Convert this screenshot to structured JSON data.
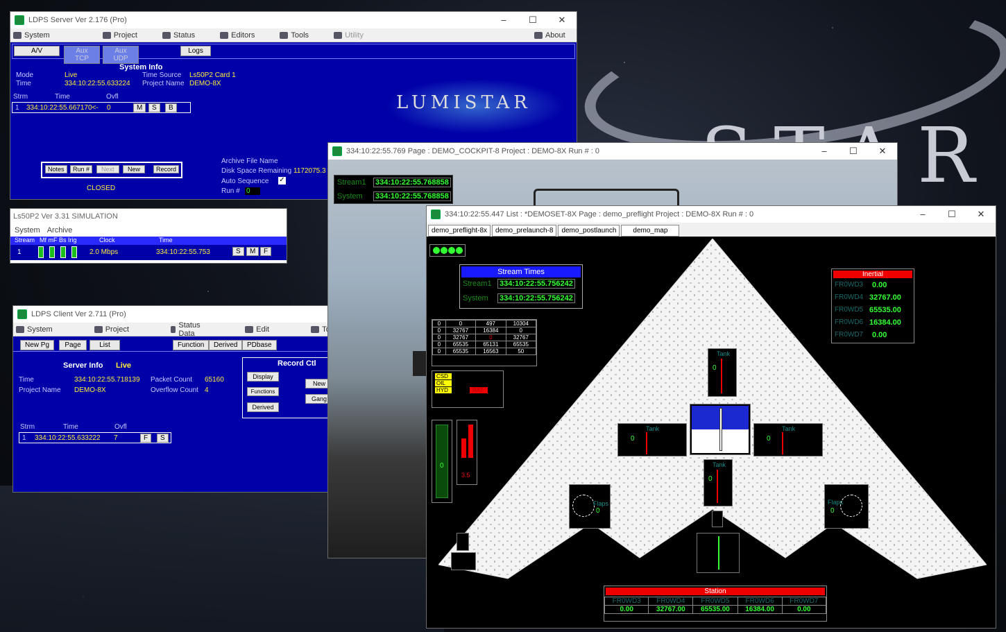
{
  "server": {
    "title": "LDPS Server  Ver 2.176  (Pro)",
    "menu": [
      "System",
      "Project",
      "Status",
      "Editors",
      "Tools",
      "Utility",
      "About"
    ],
    "toolbar": {
      "av": "A/V",
      "tcp": "Aux TCP",
      "udp": "Aux UDP",
      "logs": "Logs"
    },
    "system_info_title": "System Info",
    "mode_label": "Mode",
    "mode_value": "Live",
    "time_label": "Time",
    "time_value": "334:10:22:55.633224",
    "time_source_label": "Time Source",
    "time_source_value": "Ls50P2  Card 1",
    "project_name_label": "Project Name",
    "project_name_value": "DEMO-8X",
    "cols": {
      "strm": "Strm",
      "time": "Time",
      "ovfl": "Ovfl"
    },
    "row": {
      "strm": "1",
      "time": "334:10:22:55.667170<-",
      "ovfl": "0"
    },
    "row_btns": [
      "M",
      "S",
      "B"
    ],
    "record_btns": [
      "Notes",
      "Run #",
      "Next",
      "New",
      "Record"
    ],
    "closed": "CLOSED",
    "archive_label": "Archive File Name",
    "disk_label": "Disk Space Remaining",
    "disk_value": "1172075.3",
    "autoseq_label": "Auto Sequence",
    "run_label": "Run #",
    "run_value": "0",
    "logo": "LUMISTAR"
  },
  "ls50": {
    "title": "Ls50P2 Ver 3.31  SIMULATION",
    "menu": [
      "System",
      "Archive"
    ],
    "header": {
      "stream": "Stream",
      "flags": "Mf  mF  Bs  Irig",
      "clock": "Clock",
      "time": "Time"
    },
    "row": {
      "stream": "1",
      "clock": "2.0 Mbps",
      "time": "334:10:22:55.753"
    },
    "btns": [
      "S",
      "M",
      "F"
    ]
  },
  "client": {
    "title": "LDPS Client  Ver 2.711  (Pro)",
    "menu": [
      "System",
      "Project",
      "Status Data",
      "Edit",
      "Tools"
    ],
    "toolbar": [
      "New Pg",
      "Page",
      "List",
      "Function",
      "Derived",
      "PDbase"
    ],
    "server_info_label": "Server Info",
    "server_info_value": "Live",
    "time_label": "Time",
    "time_value": "334:10:22:55.718139",
    "project_label": "Project Name",
    "project_value": "DEMO-8X",
    "packet_label": "Packet Count",
    "packet_value": "65160",
    "overflow_label": "Overflow Count",
    "overflow_value": "4",
    "record_ctl": "Record Ctl",
    "record_btns": [
      "Display",
      "Functions",
      "Derived"
    ],
    "side_btns": [
      "New",
      "Gang"
    ],
    "cols": {
      "strm": "Strm",
      "time": "Time",
      "ovfl": "Ovfl"
    },
    "row": {
      "strm": "1",
      "time": "334:10:22:55.633222",
      "ovfl": "7"
    },
    "row_btns": [
      "F",
      "S"
    ]
  },
  "cockpit": {
    "title": "334:10:22:55.769   Page : DEMO_COCKPIT-8         Project : DEMO-8X     Run # : 0",
    "stream1_label": "Stream1",
    "stream1_value": "334:10:22:55.768858",
    "system_label": "System",
    "system_value": "334:10:22:55.768858"
  },
  "demo": {
    "title": "334:10:22:55.447   List : *DEMOSET-8X          Page : demo_preflight   Project : DEMO-8X   Run # : 0",
    "tabs": [
      "demo_preflight-8x",
      "demo_prelaunch-8",
      "demo_postlaunch",
      "demo_map"
    ],
    "stream_times": {
      "title": "Stream Times",
      "stream1_label": "Stream1",
      "stream1_value": "334:10:22:55.756242",
      "system_label": "System",
      "system_value": "334:10:22:55.756242"
    },
    "matrix": [
      [
        "0",
        "0",
        "497",
        "10304"
      ],
      [
        "0",
        "32767",
        "16384",
        "0"
      ],
      [
        "0",
        "32767",
        "0",
        "32767"
      ],
      [
        "0",
        "65535",
        "65131",
        "65535"
      ],
      [
        "0",
        "65535",
        "16563",
        "50"
      ]
    ],
    "warnings": [
      "CSD",
      "OIL",
      "HYD",
      "RAT"
    ],
    "bar_value": "0",
    "bar_pair_value": "3.5",
    "inertial": {
      "title": "Inertial",
      "rows": [
        {
          "label": "FR0WD3",
          "value": "0.00"
        },
        {
          "label": "FR0WD4",
          "value": "32767.00"
        },
        {
          "label": "FR0WD5",
          "value": "65535.00"
        },
        {
          "label": "FR0WD6",
          "value": "16384.00"
        },
        {
          "label": "FR0WD7",
          "value": "0.00"
        }
      ]
    },
    "tank_label": "Tank",
    "tank_value": "0",
    "flaps_label": "Flaps",
    "flaps_value": "0",
    "station": {
      "title": "Station",
      "labels": [
        "FR0WD3",
        "FR0WD4",
        "FR0WD5",
        "FR0WD6",
        "FR0WD7"
      ],
      "values": [
        "0.00",
        "32767.00",
        "65535.00",
        "16384.00",
        "0.00"
      ]
    }
  },
  "colors": {
    "panel_blue": "#0000a8",
    "text_yellow": "#ffeb3b",
    "text_green": "#33ff33",
    "alert_red": "#e00000"
  }
}
